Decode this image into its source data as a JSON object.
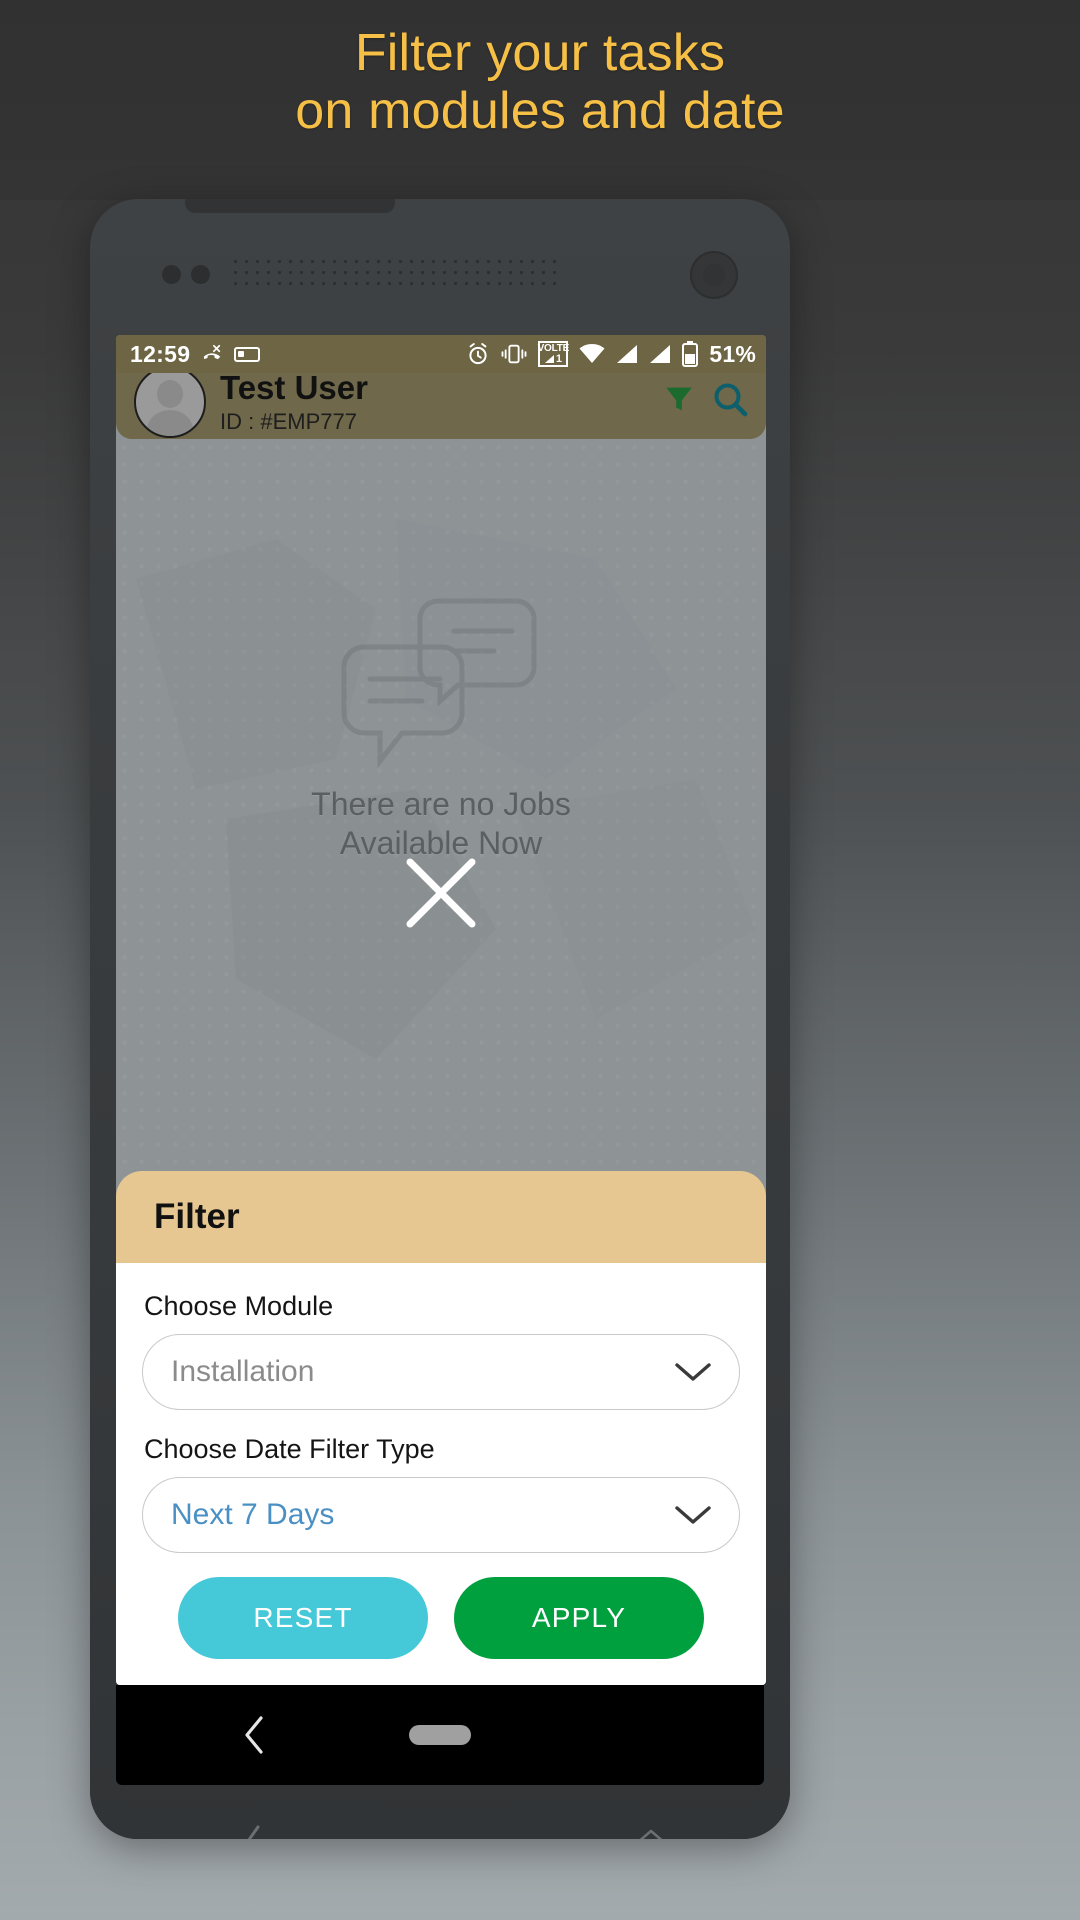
{
  "promo": {
    "headline_line1": "Filter your tasks",
    "headline_line2": "on modules and date",
    "headline_color": "#f6bf46",
    "background_color": "#343434"
  },
  "status_bar": {
    "time": "12:59",
    "battery_percent": "51%",
    "volte_label": "VOLTE",
    "volte_sim": "1",
    "icons": [
      "missed-call-icon",
      "sd-card-icon",
      "alarm-icon",
      "vibrate-icon",
      "volte-icon",
      "wifi-icon",
      "signal-sim1-icon",
      "signal-sim2-icon",
      "battery-icon"
    ],
    "background_color": "#6d6544",
    "text_color": "#ffffff"
  },
  "app_header": {
    "user_name": "Test User",
    "user_id": "ID : #EMP777",
    "avatar_label": "avatar",
    "filter_icon": "funnel-icon",
    "search_icon": "search-icon",
    "background_color": "#6d6544"
  },
  "empty_state": {
    "line1": "There are no Jobs",
    "line2": "Available Now",
    "illustration": "chat-bubbles-icon",
    "text_color": "#5a5f61"
  },
  "overlay": {
    "close_icon": "close-x-icon"
  },
  "filter_sheet": {
    "title": "Filter",
    "header_color": "#e7c791",
    "module": {
      "label": "Choose Module",
      "value": "Installation",
      "placeholder": "Installation",
      "state": "placeholder",
      "chevron_icon": "chevron-down-icon"
    },
    "date_filter": {
      "label": "Choose Date Filter Type",
      "value": "Next 7 Days",
      "placeholder": "Choose Date Filter Type",
      "state": "chosen",
      "value_color": "#4a90c4",
      "chevron_icon": "chevron-down-icon"
    },
    "buttons": {
      "reset_label": "RESET",
      "reset_color": "#45c8d8",
      "apply_label": "APPLY",
      "apply_color": "#00a03f"
    }
  },
  "nav_bar": {
    "back_icon": "back-chevron-icon",
    "home_icon": "home-pill-icon",
    "background_color": "#000000"
  },
  "device_nav_hints": {
    "back_icon": "back-chevron-icon",
    "home_icon": "home-outline-icon"
  }
}
